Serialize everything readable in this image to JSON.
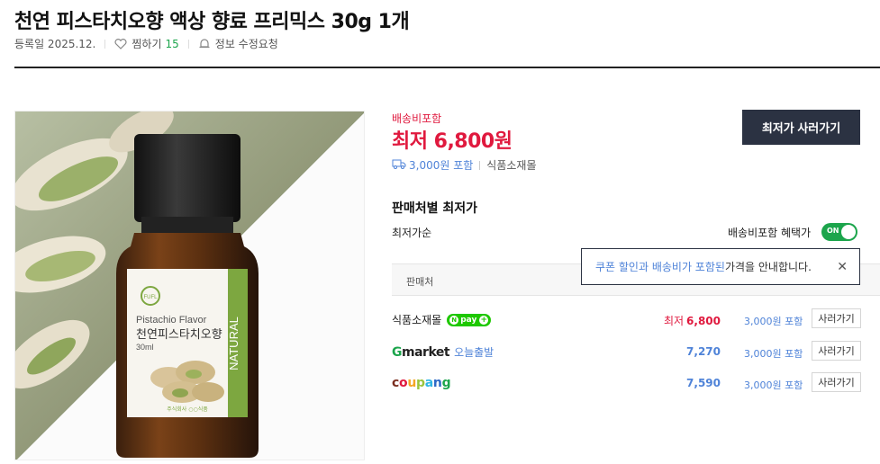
{
  "product": {
    "title": "천연 피스타치오향 액상 향료 프리믹스 30g 1개",
    "registered": "등록일 2025.12.",
    "wish_label": "찜하기",
    "wish_count": "15",
    "report_label": "정보 수정요청"
  },
  "image": {
    "brand": "FUFL",
    "flavor_en": "Pistachio Flavor",
    "flavor_ko": "천연피스타치오향",
    "volume": "30ml",
    "side_text": "NATURAL",
    "maker": "주식회사 ○○식품"
  },
  "price_box": {
    "shipping_note": "배송비포함",
    "lowest_price": "최저 6,800원",
    "shipping_fee": "3,000원 포함",
    "mall": "식품소재몰",
    "buy_button": "최저가 사러가기"
  },
  "sellers_section": {
    "title": "판매처별 최저가",
    "sort_label": "최저가순",
    "toggle_label": "배송비포함 혜택가",
    "toggle_state": "ON",
    "table_header": "판매처",
    "tooltip": {
      "highlight": "쿠폰 할인과 배송비가 포함된",
      "rest": " 가격을 안내합니다.",
      "close": "✕"
    },
    "rows": [
      {
        "seller": "식품소재몰",
        "badge": "pay",
        "price_label": "최저",
        "price": "6,800",
        "fee": "3,000원 포함",
        "button": "사러가기"
      },
      {
        "seller_g": "G",
        "seller": "market",
        "sub": "오늘출발",
        "price_label": "",
        "price": "7,270",
        "fee": "3,000원 포함",
        "button": "사러가기"
      },
      {
        "seller": "coupang",
        "price_label": "",
        "price": "7,590",
        "fee": "3,000원 포함",
        "button": "사러가기"
      }
    ]
  },
  "colors": {
    "accent_red": "#e0193e",
    "link_blue": "#4f83d8",
    "green": "#1ca54c",
    "dark_button": "#2b3242"
  }
}
